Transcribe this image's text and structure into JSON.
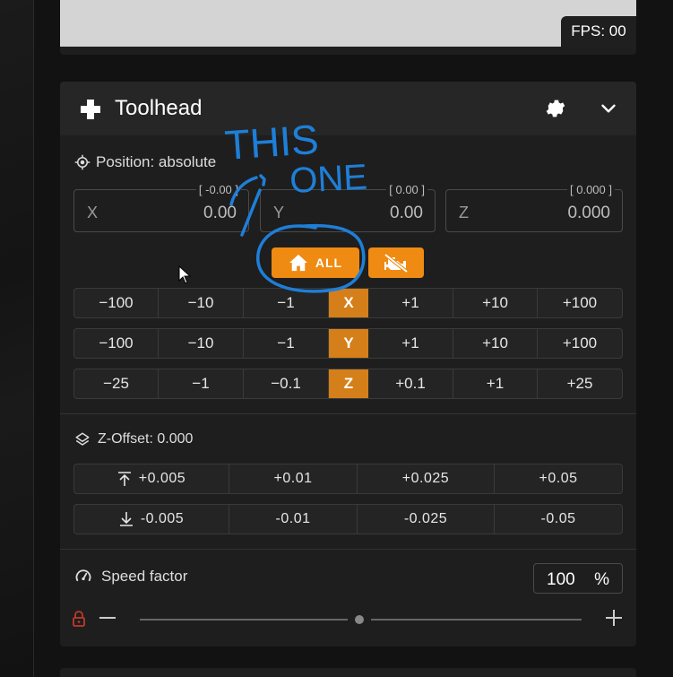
{
  "webcam": {
    "fps_label": "FPS: 00"
  },
  "toolhead": {
    "title": "Toolhead",
    "position_label": "Position: absolute",
    "coords": [
      {
        "axis": "X",
        "value": "0.00",
        "hint": "[ -0.00 ]"
      },
      {
        "axis": "Y",
        "value": "0.00",
        "hint": "[ 0.00 ]"
      },
      {
        "axis": "Z",
        "value": "0.000",
        "hint": "[ 0.000 ]"
      }
    ],
    "home_all_label": "ALL",
    "jog_rows": [
      {
        "axis": "X",
        "neg": [
          "−100",
          "−10",
          "−1"
        ],
        "pos": [
          "+1",
          "+10",
          "+100"
        ]
      },
      {
        "axis": "Y",
        "neg": [
          "−100",
          "−10",
          "−1"
        ],
        "pos": [
          "+1",
          "+10",
          "+100"
        ]
      },
      {
        "axis": "Z",
        "neg": [
          "−25",
          "−1",
          "−0.1"
        ],
        "pos": [
          "+0.1",
          "+1",
          "+25"
        ]
      }
    ],
    "z_offset_label": "Z-Offset: 0.000",
    "z_offset_up": [
      "+0.005",
      "+0.01",
      "+0.025",
      "+0.05"
    ],
    "z_offset_down": [
      "-0.005",
      "-0.01",
      "-0.025",
      "-0.05"
    ],
    "speed_factor_label": "Speed factor",
    "speed_factor_value": "100",
    "speed_factor_unit": "%",
    "speed_slider_level": 0.5
  },
  "annotation": {
    "line1": "THIS",
    "line2": "ONE"
  },
  "colors": {
    "accent": "#ef8a12",
    "axis_cell": "#d57f1a",
    "annotation_ink": "#1e7fd8",
    "lock": "#c0392b"
  },
  "icons": {
    "toolhead": "gamepad-icon",
    "settings": "gear-icon",
    "collapse": "chevron-down-icon",
    "position": "crosshairs-gps-icon",
    "home": "home-icon",
    "motors_off": "engine-off-icon",
    "z_offset": "layers-icon",
    "z_up": "arrow-collapse-up-icon",
    "z_down": "arrow-collapse-down-icon",
    "speed": "speedometer-icon",
    "lock": "lock-icon",
    "decrease": "minus-icon",
    "increase": "plus-icon"
  }
}
